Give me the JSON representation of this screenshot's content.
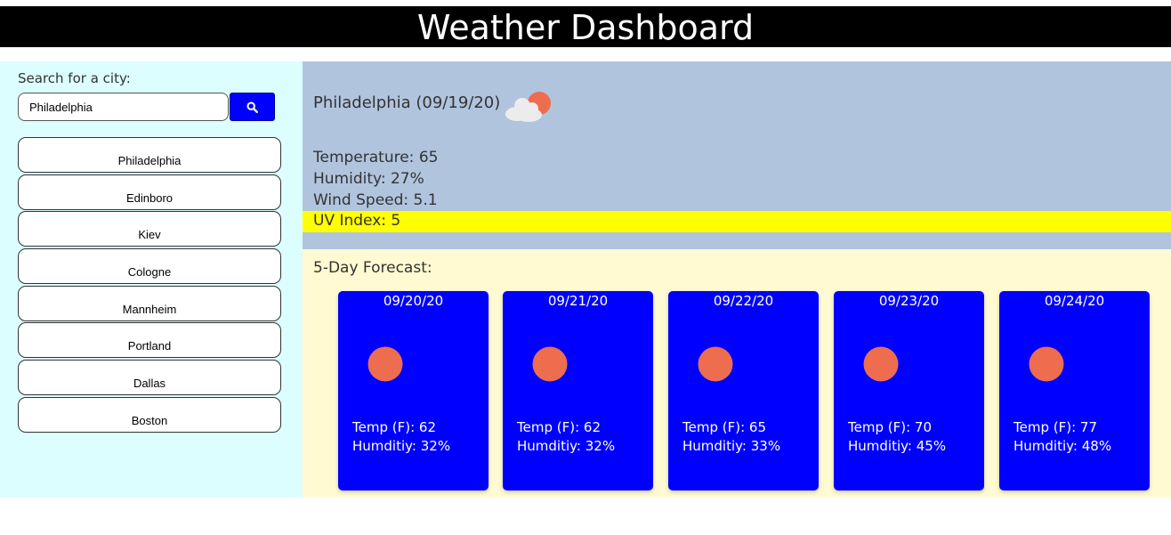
{
  "header": {
    "title": "Weather Dashboard"
  },
  "search": {
    "label": "Search for a city:",
    "value": "Philadelphia",
    "button_icon": "search-icon"
  },
  "history": [
    "Philadelphia",
    "Edinboro",
    "Kiev",
    "Cologne",
    "Mannheim",
    "Portland",
    "Dallas",
    "Boston"
  ],
  "current": {
    "title": "Philadelphia (09/19/20)",
    "icon": "partly-cloudy-icon",
    "temperature": "Temperature: 65",
    "humidity": "Humidity: 27%",
    "wind": "Wind Speed: 5.1",
    "uv": "UV Index: 5",
    "uv_color": "#ffff00"
  },
  "forecast": {
    "title": "5-Day Forecast:",
    "days": [
      {
        "date": "09/20/20",
        "icon": "sun-icon",
        "temp": "Temp (F): 62",
        "humidity": "Humditiy: 32%"
      },
      {
        "date": "09/21/20",
        "icon": "sun-icon",
        "temp": "Temp (F): 62",
        "humidity": "Humditiy: 32%"
      },
      {
        "date": "09/22/20",
        "icon": "sun-icon",
        "temp": "Temp (F): 65",
        "humidity": "Humditiy: 33%"
      },
      {
        "date": "09/23/20",
        "icon": "sun-icon",
        "temp": "Temp (F): 70",
        "humidity": "Humditiy: 45%"
      },
      {
        "date": "09/24/20",
        "icon": "sun-icon",
        "temp": "Temp (F): 77",
        "humidity": "Humditiy: 48%"
      }
    ]
  },
  "colors": {
    "header_bg": "#000000",
    "sidebar_bg": "#dcfefe",
    "current_bg": "#b0c4de",
    "forecast_bg": "#fffad1",
    "card_bg": "#0000ff",
    "accent": "#0000ff",
    "sun": "#ed6d4e"
  }
}
